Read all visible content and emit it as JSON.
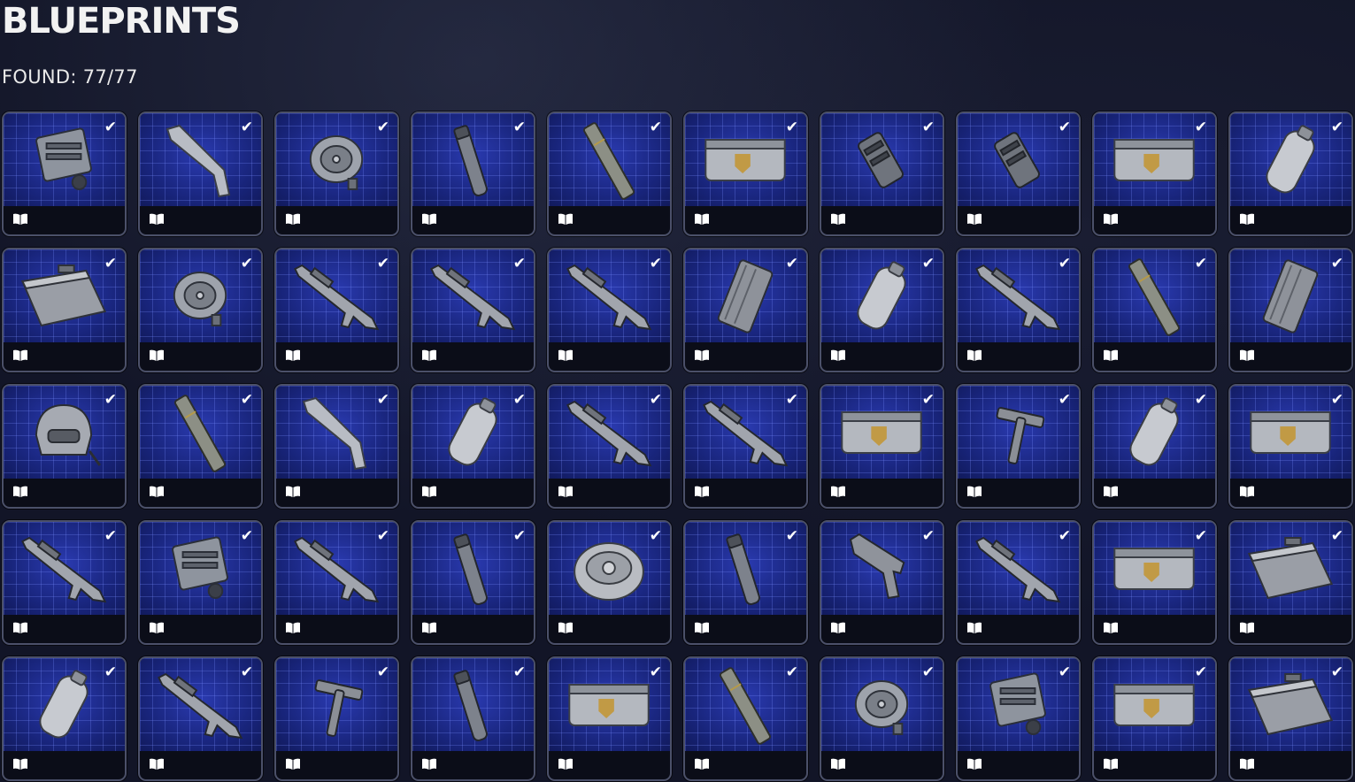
{
  "header": {
    "title": "BLUEPRINTS",
    "found_text": "FOUND: 77/77"
  },
  "theme": {
    "card_bg": "#14206e",
    "grid_line": "#6a7cff",
    "card_border": "#4b5069",
    "check_color": "#ffffff"
  },
  "card_icons": {
    "status": "checkmark-icon",
    "footer": "book-icon"
  },
  "items": [
    {
      "shape": "device",
      "collected": true
    },
    {
      "shape": "barrel",
      "collected": true
    },
    {
      "shape": "drum",
      "collected": true
    },
    {
      "shape": "silencer",
      "collected": true
    },
    {
      "shape": "rod",
      "collected": true
    },
    {
      "shape": "crate",
      "collected": true
    },
    {
      "shape": "muzzle",
      "collected": true
    },
    {
      "shape": "muzzle",
      "collected": true
    },
    {
      "shape": "crate",
      "collected": true
    },
    {
      "shape": "canister",
      "collected": true
    },
    {
      "shape": "case",
      "collected": true
    },
    {
      "shape": "drum",
      "collected": true
    },
    {
      "shape": "rifle",
      "collected": true
    },
    {
      "shape": "rifle",
      "collected": true
    },
    {
      "shape": "rifle",
      "collected": true
    },
    {
      "shape": "magazine",
      "collected": true
    },
    {
      "shape": "canister",
      "collected": true
    },
    {
      "shape": "rifle",
      "collected": true
    },
    {
      "shape": "rod",
      "collected": true
    },
    {
      "shape": "magazine",
      "collected": true
    },
    {
      "shape": "helmet",
      "collected": true
    },
    {
      "shape": "rod",
      "collected": true
    },
    {
      "shape": "barrel",
      "collected": true
    },
    {
      "shape": "canister",
      "collected": true
    },
    {
      "shape": "rifle",
      "collected": true
    },
    {
      "shape": "rifle",
      "collected": true
    },
    {
      "shape": "crate",
      "collected": true
    },
    {
      "shape": "hammer",
      "collected": true
    },
    {
      "shape": "canister",
      "collected": true
    },
    {
      "shape": "crate",
      "collected": true
    },
    {
      "shape": "rifle",
      "collected": true
    },
    {
      "shape": "device",
      "collected": true
    },
    {
      "shape": "rifle",
      "collected": true
    },
    {
      "shape": "silencer",
      "collected": true
    },
    {
      "shape": "mine",
      "collected": true
    },
    {
      "shape": "silencer",
      "collected": true
    },
    {
      "shape": "pistol",
      "collected": true
    },
    {
      "shape": "rifle",
      "collected": true
    },
    {
      "shape": "crate",
      "collected": true
    },
    {
      "shape": "case",
      "collected": true
    },
    {
      "shape": "canister",
      "collected": true
    },
    {
      "shape": "rifle",
      "collected": true
    },
    {
      "shape": "hammer",
      "collected": true
    },
    {
      "shape": "silencer",
      "collected": true
    },
    {
      "shape": "crate",
      "collected": true
    },
    {
      "shape": "rod",
      "collected": true
    },
    {
      "shape": "drum",
      "collected": true
    },
    {
      "shape": "device",
      "collected": true
    },
    {
      "shape": "crate",
      "collected": true
    },
    {
      "shape": "case",
      "collected": true
    }
  ]
}
